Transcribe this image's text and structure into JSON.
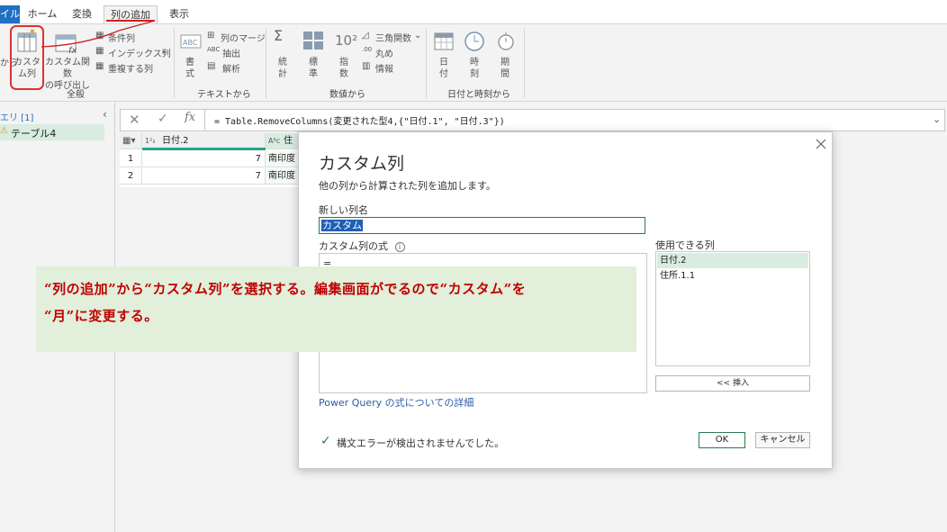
{
  "tabs": {
    "file": "イル",
    "home": "ホーム",
    "transform": "変換",
    "add_column": "列の追加",
    "view": "表示"
  },
  "ribbon": {
    "general": {
      "partial_label": "から",
      "custom_column_label_1": "カスタ",
      "custom_column_label_2": "ム列",
      "custom_function_label_1": "カスタム関数",
      "custom_function_label_2": "の呼び出し",
      "conditional_column": "条件列",
      "index_column": "インデックス列",
      "duplicate_column": "重複する列",
      "group_label": "全般"
    },
    "text": {
      "format_label_1": "書",
      "format_label_2": "式",
      "merge_columns": "列のマージ",
      "extract": "抽出",
      "parse": "解析",
      "group_label": "テキストから"
    },
    "number": {
      "statistics_1": "統",
      "statistics_2": "計",
      "standard_1": "標",
      "standard_2": "準",
      "scientific_1": "指",
      "scientific_2": "数",
      "trigonometry": "三角関数",
      "rounding": "丸め",
      "information": "情報",
      "group_label": "数値から"
    },
    "datetime": {
      "date_1": "日",
      "date_2": "付",
      "time_1": "時",
      "time_2": "刻",
      "duration_1": "期",
      "duration_2": "間",
      "group_label": "日付と時刻から"
    }
  },
  "left_panel": {
    "header": "エリ [1]",
    "query_name": "テーブル4"
  },
  "formula_bar": {
    "formula": "= Table.RemoveColumns(変更された型4,{\"日付.1\", \"日付.3\"})"
  },
  "grid": {
    "col1_type": "1²₃",
    "col1_header": "日付.2",
    "col2_type": "Aᴮc",
    "col2_header": "住所",
    "rows": [
      {
        "index": "1",
        "value": "7",
        "text": "南印度"
      },
      {
        "index": "2",
        "value": "7",
        "text": "南印度"
      }
    ]
  },
  "dialog": {
    "title": "カスタム列",
    "description": "他の列から計算された列を追加します。",
    "new_name_label": "新しい列名",
    "new_name_value": "カスタム",
    "formula_label": "カスタム列の式",
    "formula_value": "=",
    "available_label": "使用できる列",
    "available_columns": [
      "日付.2",
      "住所.1.1"
    ],
    "insert_button": "<< 挿入",
    "learn_more_link": "Power Query の式についての詳細",
    "status": "構文エラーが検出されませんでした。",
    "ok_button": "OK",
    "cancel_button": "キャンセル"
  },
  "annotation": {
    "line1": "“列の追加”から“カスタム列”を選択する。編集画面がでるので“カスタム”を",
    "line2": "“月”に変更する。"
  },
  "colors": {
    "accent_blue": "#1f6fc2",
    "selection_green": "#d9ece1",
    "annotation_bg": "#e2efda",
    "annotation_text": "#c00000",
    "callout_red": "#e03030"
  }
}
